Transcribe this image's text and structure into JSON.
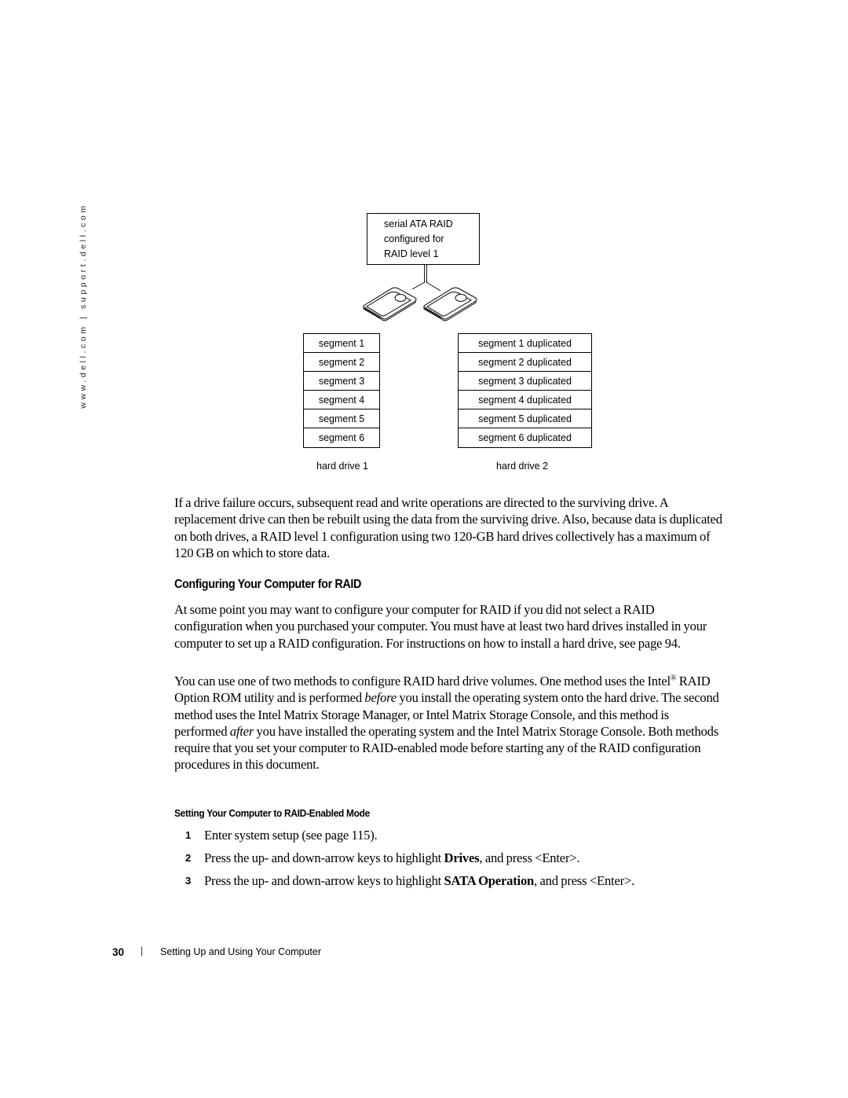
{
  "side_url": "www.dell.com | support.dell.com",
  "diagram": {
    "raid_box_lines": [
      "serial ATA RAID",
      "configured for",
      "RAID level 1"
    ],
    "hard_drive_1": {
      "label": "hard drive 1",
      "segments": [
        "segment 1",
        "segment 2",
        "segment 3",
        "segment 4",
        "segment 5",
        "segment 6"
      ]
    },
    "hard_drive_2": {
      "label": "hard drive 2",
      "segments": [
        "segment 1 duplicated",
        "segment 2 duplicated",
        "segment 3 duplicated",
        "segment 4 duplicated",
        "segment 5 duplicated",
        "segment 6 duplicated"
      ]
    }
  },
  "paragraph_1": "If a drive failure occurs, subsequent read and write operations are directed to the surviving drive. A replacement drive can then be rebuilt using the data from the surviving drive. Also, because data is duplicated on both drives, a RAID level 1 configuration using two 120-GB hard drives collectively has a maximum of 120 GB on which to store data.",
  "section_heading": "Configuring Your Computer for RAID",
  "paragraph_2": "At some point you may want to configure your computer for RAID if you did not select a RAID configuration when you purchased your computer. You must have at least two hard drives installed in your computer to set up a RAID configuration. For instructions on how to install a hard drive, see page 94.",
  "paragraph_3": {
    "part1": "You can use one of two methods to configure RAID hard drive volumes. One method uses the Intel",
    "reg_mark": "®",
    "part2": " RAID Option ROM utility and is performed ",
    "em1": "before",
    "part3": " you install the operating system onto the hard drive. The second method uses the Intel Matrix Storage Manager, or Intel Matrix Storage Console, and this method is performed ",
    "em2": "after",
    "part4": " you have installed the operating system and the Intel Matrix Storage Console. Both methods require that you set your computer to RAID-enabled mode before starting any of the RAID configuration procedures in this document."
  },
  "subheading": "Setting Your Computer to RAID-Enabled Mode",
  "steps": [
    {
      "num": "1",
      "pre": "Enter system setup (see page 115).",
      "bold": "",
      "post": ""
    },
    {
      "num": "2",
      "pre": "Press the up- and down-arrow keys to highlight ",
      "bold": "Drives",
      "post": ", and press <Enter>."
    },
    {
      "num": "3",
      "pre": "Press the up- and down-arrow keys to highlight ",
      "bold": "SATA Operation",
      "post": ", and press <Enter>."
    }
  ],
  "footer": {
    "page_number": "30",
    "separator": "|",
    "chapter_title": "Setting Up and Using Your Computer"
  }
}
